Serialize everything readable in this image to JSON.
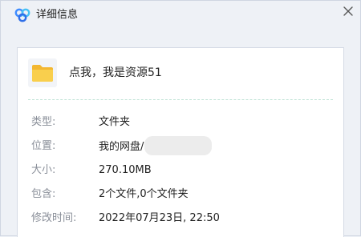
{
  "dialog": {
    "title": "详细信息",
    "logo_icon": "cloud-logo-icon",
    "close_icon": "close-icon"
  },
  "file": {
    "icon": "folder-icon",
    "name": "点我，我是资源51"
  },
  "details": {
    "type": {
      "label": "类型:",
      "value": "文件夹"
    },
    "location": {
      "label": "位置:",
      "value": "我的网盘/"
    },
    "size": {
      "label": "大小:",
      "value": "270.10MB"
    },
    "contains": {
      "label": "包含:",
      "value": "2个文件,0个文件夹"
    },
    "modified": {
      "label": "修改时间:",
      "value": "2022年07月23日, 22:50"
    }
  },
  "colors": {
    "background": "#eef1f6",
    "panel": "#ffffff",
    "folder": "#f7c94a",
    "logo_blue": "#3f8cff",
    "divider": "#bfe3d6"
  }
}
